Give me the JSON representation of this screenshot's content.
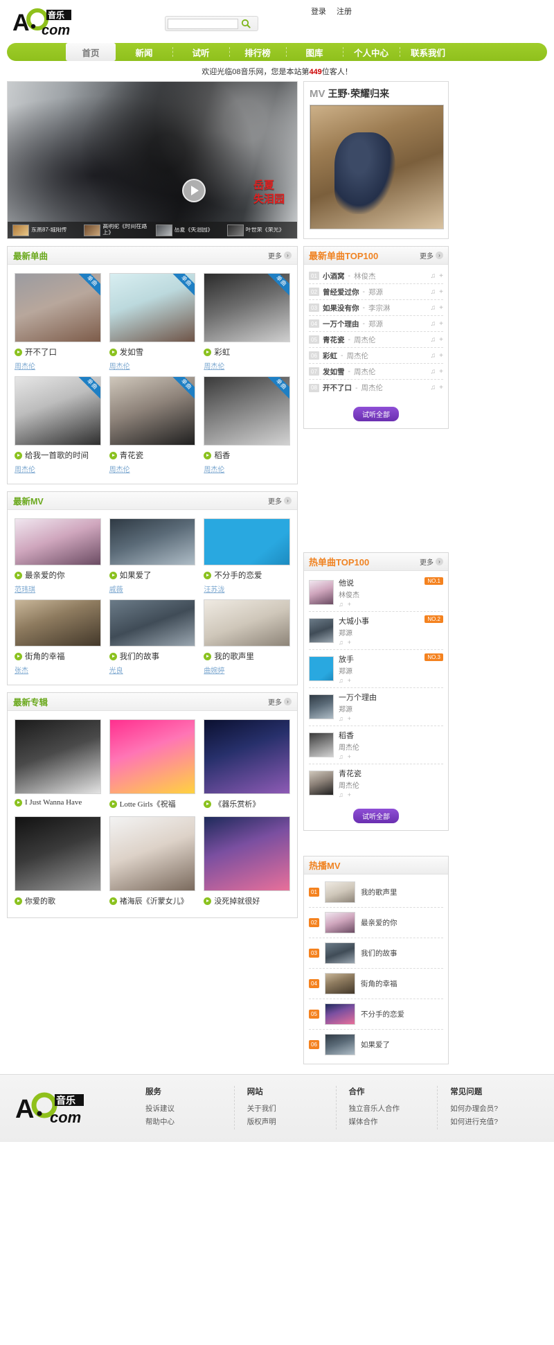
{
  "header": {
    "login_label": "登录",
    "register_label": "注册",
    "search_placeholder": "",
    "search_value": "",
    "search_icon": "search-icon"
  },
  "nav": {
    "items": [
      {
        "label": "首页",
        "active": true
      },
      {
        "label": "新闻",
        "active": false
      },
      {
        "label": "试听",
        "active": false
      },
      {
        "label": "排行榜",
        "active": false
      },
      {
        "label": "图库",
        "active": false
      },
      {
        "label": "个人中心",
        "active": false
      },
      {
        "label": "联系我们",
        "active": false
      }
    ]
  },
  "welcome": {
    "prefix": "欢迎光临08音乐网，您是本站第",
    "count": "449",
    "suffix": "位客人！"
  },
  "hero": {
    "artist": "岳夏",
    "song": "失泪园",
    "thumbs": [
      {
        "label": "东燕87-城阳传"
      },
      {
        "label": "高明驼《时间在路上》"
      },
      {
        "label": "岳夏《失泪园》"
      },
      {
        "label": "叶世荣《荣光》"
      }
    ]
  },
  "mv_feature": {
    "tag": "MV",
    "title": "王野·荣耀归来"
  },
  "sections": {
    "latest_single": {
      "title": "最新单曲",
      "more": "更多"
    },
    "latest_mv": {
      "title": "最新MV",
      "more": "更多"
    },
    "latest_album": {
      "title": "最新专辑",
      "more": "更多"
    }
  },
  "latest_singles": [
    {
      "name": "开不了口",
      "artist": "周杰伦",
      "badge": "单曲",
      "fill": "ph1"
    },
    {
      "name": "发如雪",
      "artist": "周杰伦",
      "badge": "单曲",
      "fill": "ph2"
    },
    {
      "name": "彩虹",
      "artist": "周杰伦",
      "badge": "单曲",
      "fill": "ph3"
    },
    {
      "name": "给我一首歌的时间",
      "artist": "周杰伦",
      "badge": "单曲",
      "fill": "ph4"
    },
    {
      "name": "青花瓷",
      "artist": "周杰伦",
      "badge": "单曲",
      "fill": "ph5"
    },
    {
      "name": "稻香",
      "artist": "周杰伦",
      "badge": "单曲",
      "fill": "ph6"
    }
  ],
  "latest_mvs": [
    {
      "name": "最亲爱的你",
      "artist": "范玮琪",
      "fill": "ph7"
    },
    {
      "name": "如果爱了",
      "artist": "戚薇",
      "fill": "ph8"
    },
    {
      "name": "不分手的恋爱",
      "artist": "汪苏泷",
      "fill": "ph9"
    },
    {
      "name": "街角的幸福",
      "artist": "张杰",
      "fill": "ph10"
    },
    {
      "name": "我们的故事",
      "artist": "光良",
      "fill": "ph11"
    },
    {
      "name": "我的歌声里",
      "artist": "曲婉婷",
      "fill": "ph12"
    }
  ],
  "latest_albums": [
    {
      "name": "I Just Wanna Have",
      "fill": "ph13"
    },
    {
      "name": "Lotte Girls《祝福",
      "fill": "ph14"
    },
    {
      "name": "《器乐赏析》",
      "fill": "ph15"
    },
    {
      "name": "你爱的歌",
      "fill": "ph16"
    },
    {
      "name": "褚海辰《沂蒙女儿》",
      "fill": "ph17"
    },
    {
      "name": "没死掉就很好",
      "fill": "ph18"
    }
  ],
  "top100_new": {
    "title": "最新单曲TOP100",
    "more": "更多",
    "listen_all": "试听全部",
    "items": [
      {
        "rank": "01",
        "song": "小酒窝",
        "artist": "林俊杰"
      },
      {
        "rank": "02",
        "song": "曾经爱过你",
        "artist": "郑源"
      },
      {
        "rank": "03",
        "song": "如果没有你",
        "artist": "李宗淋"
      },
      {
        "rank": "04",
        "song": "一万个理由",
        "artist": "郑源"
      },
      {
        "rank": "05",
        "song": "青花瓷",
        "artist": "周杰伦"
      },
      {
        "rank": "06",
        "song": "彩虹",
        "artist": "周杰伦"
      },
      {
        "rank": "07",
        "song": "发如雪",
        "artist": "周杰伦"
      },
      {
        "rank": "08",
        "song": "开不了口",
        "artist": "周杰伦"
      }
    ]
  },
  "top100_hot": {
    "title": "热单曲TOP100",
    "more": "更多",
    "listen_all": "试听全部",
    "items": [
      {
        "song": "他说",
        "artist": "林俊杰",
        "badge": "NO.1",
        "fill": "ph7"
      },
      {
        "song": "大城小事",
        "artist": "郑源",
        "badge": "NO.2",
        "fill": "ph11"
      },
      {
        "song": "放手",
        "artist": "郑源",
        "badge": "NO.3",
        "fill": "ph9"
      },
      {
        "song": "一万个理由",
        "artist": "郑源",
        "badge": "",
        "fill": "ph8"
      },
      {
        "song": "稻香",
        "artist": "周杰伦",
        "badge": "",
        "fill": "ph6"
      },
      {
        "song": "青花瓷",
        "artist": "周杰伦",
        "badge": "",
        "fill": "ph5"
      }
    ]
  },
  "hot_mv": {
    "title": "热播MV",
    "items": [
      {
        "rank": "01",
        "name": "我的歌声里",
        "fill": "ph12"
      },
      {
        "rank": "02",
        "name": "最亲爱的你",
        "fill": "ph7"
      },
      {
        "rank": "03",
        "name": "我们的故事",
        "fill": "ph11"
      },
      {
        "rank": "04",
        "name": "街角的幸福",
        "fill": "ph10"
      },
      {
        "rank": "05",
        "name": "不分手的恋爱",
        "fill": "ph18"
      },
      {
        "rank": "06",
        "name": "如果爱了",
        "fill": "ph8"
      }
    ]
  },
  "footer": {
    "columns": [
      {
        "title": "服务",
        "links": [
          "投诉建议",
          "帮助中心"
        ]
      },
      {
        "title": "网站",
        "links": [
          "关于我们",
          "版权声明"
        ]
      },
      {
        "title": "合作",
        "links": [
          "独立音乐人合作",
          "媒体合作"
        ]
      },
      {
        "title": "常见问题",
        "links": [
          "如何办理会员?",
          "如何进行充值?"
        ]
      }
    ]
  },
  "icons": {
    "headphone": "♪",
    "plus": "+",
    "more_arrow": "›"
  }
}
